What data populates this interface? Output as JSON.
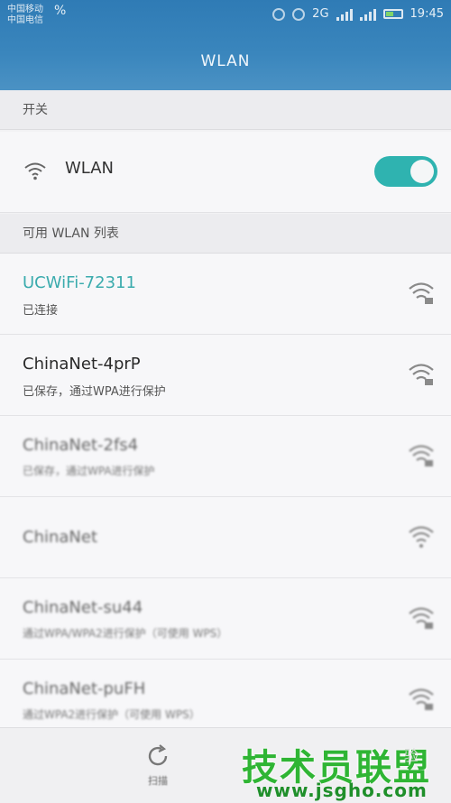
{
  "statusbar": {
    "carrier_line1": "中国移动",
    "carrier_line2": "中国电信",
    "carrier_pct": "%",
    "network_tag": "2G",
    "time": "19:45"
  },
  "header": {
    "title": "WLAN"
  },
  "switch_section": {
    "title": "开关"
  },
  "wlan_toggle": {
    "label": "WLAN",
    "state": "on"
  },
  "list_section": {
    "title": "可用 WLAN 列表"
  },
  "networks": [
    {
      "name": "UCWiFi-72311",
      "status": "已连接",
      "connected": true
    },
    {
      "name": "ChinaNet-4prP",
      "status": "已保存，通过WPA进行保护",
      "connected": false
    },
    {
      "name": "ChinaNet-2fs4",
      "status": "已保存，通过WPA进行保护",
      "connected": false
    },
    {
      "name": "ChinaNet",
      "status": "",
      "connected": false
    },
    {
      "name": "ChinaNet-su44",
      "status": "通过WPA/WPA2进行保护（可使用 WPS）",
      "connected": false
    },
    {
      "name": "ChinaNet-puFH",
      "status": "通过WPA2进行保护（可使用 WPS）",
      "connected": false
    }
  ],
  "bottom": {
    "refresh_label": "扫描"
  },
  "watermark": {
    "brand": "技术员联盟",
    "side": "验",
    "url": "www.jsgho.com"
  },
  "colors": {
    "accent": "#2fb3b0",
    "appbar": "#3a86bd",
    "watermark": "#2fb534"
  }
}
